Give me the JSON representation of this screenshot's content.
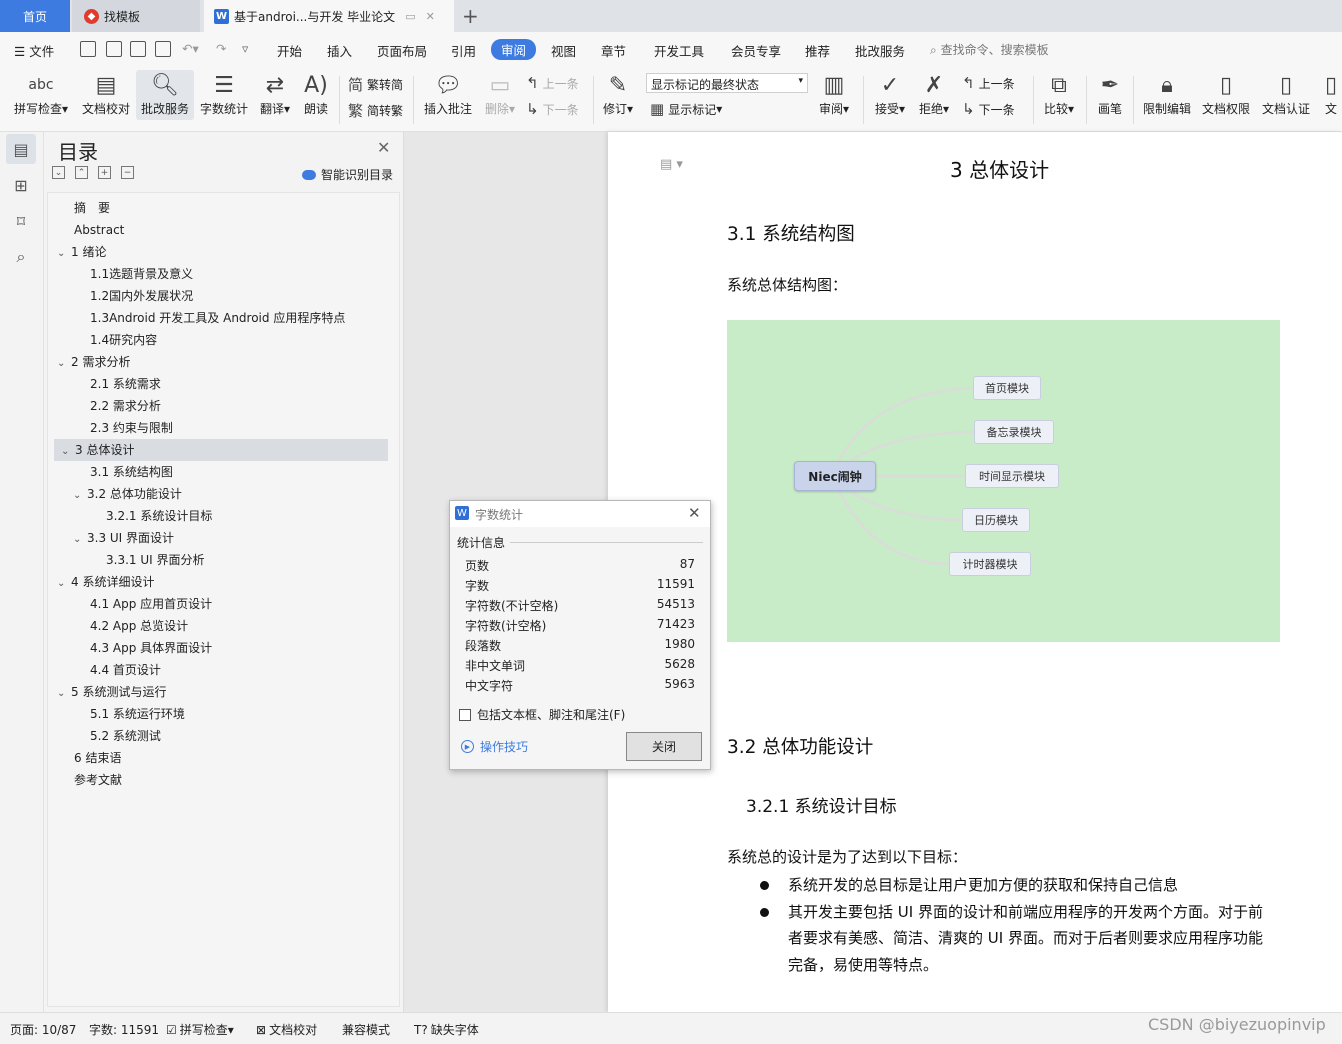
{
  "tabs": {
    "home": "首页",
    "templates": "找模板",
    "document": "基于androi...与开发 毕业论文"
  },
  "menu": {
    "file": "文件",
    "items": [
      "开始",
      "插入",
      "页面布局",
      "引用",
      "审阅",
      "视图",
      "章节",
      "开发工具",
      "会员专享",
      "推荐",
      "批改服务"
    ],
    "active": "审阅",
    "search": "查找命令、搜索模板"
  },
  "ribbon": {
    "big": [
      {
        "label": "拼写检查",
        "icon": "abc"
      },
      {
        "label": "文档校对",
        "icon": "doc-check-icon"
      },
      {
        "label": "批改服务",
        "icon": "review-icon"
      },
      {
        "label": "字数统计",
        "icon": "word-count-icon"
      },
      {
        "label": "翻译",
        "icon": "translate-icon"
      },
      {
        "label": "朗读",
        "icon": "read-aloud-icon"
      }
    ],
    "small_convert": [
      "繁转简",
      "简转繁"
    ],
    "comment": {
      "insert": "插入批注",
      "delete": "删除",
      "prev": "上一条",
      "next": "下一条"
    },
    "revise": {
      "label": "修订",
      "dropdown": "显示标记的最终状态",
      "show_marks": "显示标记"
    },
    "review": "审阅",
    "accept": "接受",
    "reject": "拒绝",
    "prev2": "上一条",
    "next2": "下一条",
    "compare": "比较",
    "pen": "画笔",
    "restrict": "限制编辑",
    "permission": "文档权限",
    "certify": "文档认证",
    "cut": "文"
  },
  "toc": {
    "title": "目录",
    "smart": "智能识别目录",
    "items": [
      {
        "text": "摘　要",
        "level": 0,
        "arrow": ""
      },
      {
        "text": "Abstract",
        "level": 0,
        "arrow": ""
      },
      {
        "text": "1  绪论",
        "level": 0,
        "arrow": "v"
      },
      {
        "text": "1.1选题背景及意义",
        "level": 1,
        "arrow": ""
      },
      {
        "text": "1.2国内外发展状况",
        "level": 1,
        "arrow": ""
      },
      {
        "text": "1.3Android 开发工具及 Android 应用程序特点",
        "level": 1,
        "arrow": ""
      },
      {
        "text": "1.4研究内容",
        "level": 1,
        "arrow": ""
      },
      {
        "text": "2  需求分析",
        "level": 0,
        "arrow": "v"
      },
      {
        "text": "2.1  系统需求",
        "level": 1,
        "arrow": ""
      },
      {
        "text": "2.2  需求分析",
        "level": 1,
        "arrow": ""
      },
      {
        "text": "2.3  约束与限制",
        "level": 1,
        "arrow": ""
      },
      {
        "text": "3  总体设计",
        "level": 0,
        "arrow": "v",
        "selected": true
      },
      {
        "text": "3.1  系统结构图",
        "level": 1,
        "arrow": ""
      },
      {
        "text": "3.2  总体功能设计",
        "level": 1,
        "arrow": "v"
      },
      {
        "text": "3.2.1  系统设计目标",
        "level": 2,
        "arrow": ""
      },
      {
        "text": "3.3 UI 界面设计",
        "level": 1,
        "arrow": "v"
      },
      {
        "text": "3.3.1 UI 界面分析",
        "level": 2,
        "arrow": ""
      },
      {
        "text": "4  系统详细设计",
        "level": 0,
        "arrow": "v"
      },
      {
        "text": "4.1 App 应用首页设计",
        "level": 1,
        "arrow": ""
      },
      {
        "text": "4.2 App 总览设计",
        "level": 1,
        "arrow": ""
      },
      {
        "text": "4.3 App 具体界面设计",
        "level": 1,
        "arrow": ""
      },
      {
        "text": "4.4  首页设计",
        "level": 1,
        "arrow": ""
      },
      {
        "text": "5  系统测试与运行",
        "level": 0,
        "arrow": "v"
      },
      {
        "text": "5.1  系统运行环境",
        "level": 1,
        "arrow": ""
      },
      {
        "text": "5.2  系统测试",
        "level": 1,
        "arrow": ""
      },
      {
        "text": "6  结束语",
        "level": 0,
        "arrow": ""
      },
      {
        "text": "参考文献",
        "level": 0,
        "arrow": ""
      }
    ]
  },
  "document": {
    "h1": "3  总体设计",
    "h2_1": "3.1  系统结构图",
    "p1": "系统总体结构图：",
    "diagram": {
      "center": "Niec闹钟",
      "nodes": [
        "首页模块",
        "备忘录模块",
        "时间显示模块",
        "日历模块",
        "计时器模块"
      ]
    },
    "h2_2": "3.2  总体功能设计",
    "h3_1": "3.2.1  系统设计目标",
    "p2": "系统总的设计是为了达到以下目标：",
    "bullets": [
      "系统开发的总目标是让用户更加方便的获取和保持自己信息",
      "其开发主要包括 UI 界面的设计和前端应用程序的开发两个方面。对于前者要求有美感、简洁、清爽的 UI 界面。而对于后者则要求应用程序功能完备，易使用等特点。"
    ]
  },
  "dialog": {
    "title": "字数统计",
    "section": "统计信息",
    "stats": [
      {
        "label": "页数",
        "value": "87"
      },
      {
        "label": "字数",
        "value": "11591"
      },
      {
        "label": "字符数(不计空格)",
        "value": "54513"
      },
      {
        "label": "字符数(计空格)",
        "value": "71423"
      },
      {
        "label": "段落数",
        "value": "1980"
      },
      {
        "label": "非中文单词",
        "value": "5628"
      },
      {
        "label": "中文字符",
        "value": "5963"
      }
    ],
    "checkbox": "包括文本框、脚注和尾注(F)",
    "tip": "操作技巧",
    "close": "关闭"
  },
  "status": {
    "page": "页面: 10/87",
    "words": "字数: 11591",
    "spell": "拼写检查",
    "proof": "文档校对",
    "compat": "兼容模式",
    "missing_font": "缺失字体"
  },
  "watermark": "CSDN @biyezuopinvip",
  "colors": {
    "accent": "#3d7be0",
    "diagram_bg": "#c8ecc8"
  }
}
